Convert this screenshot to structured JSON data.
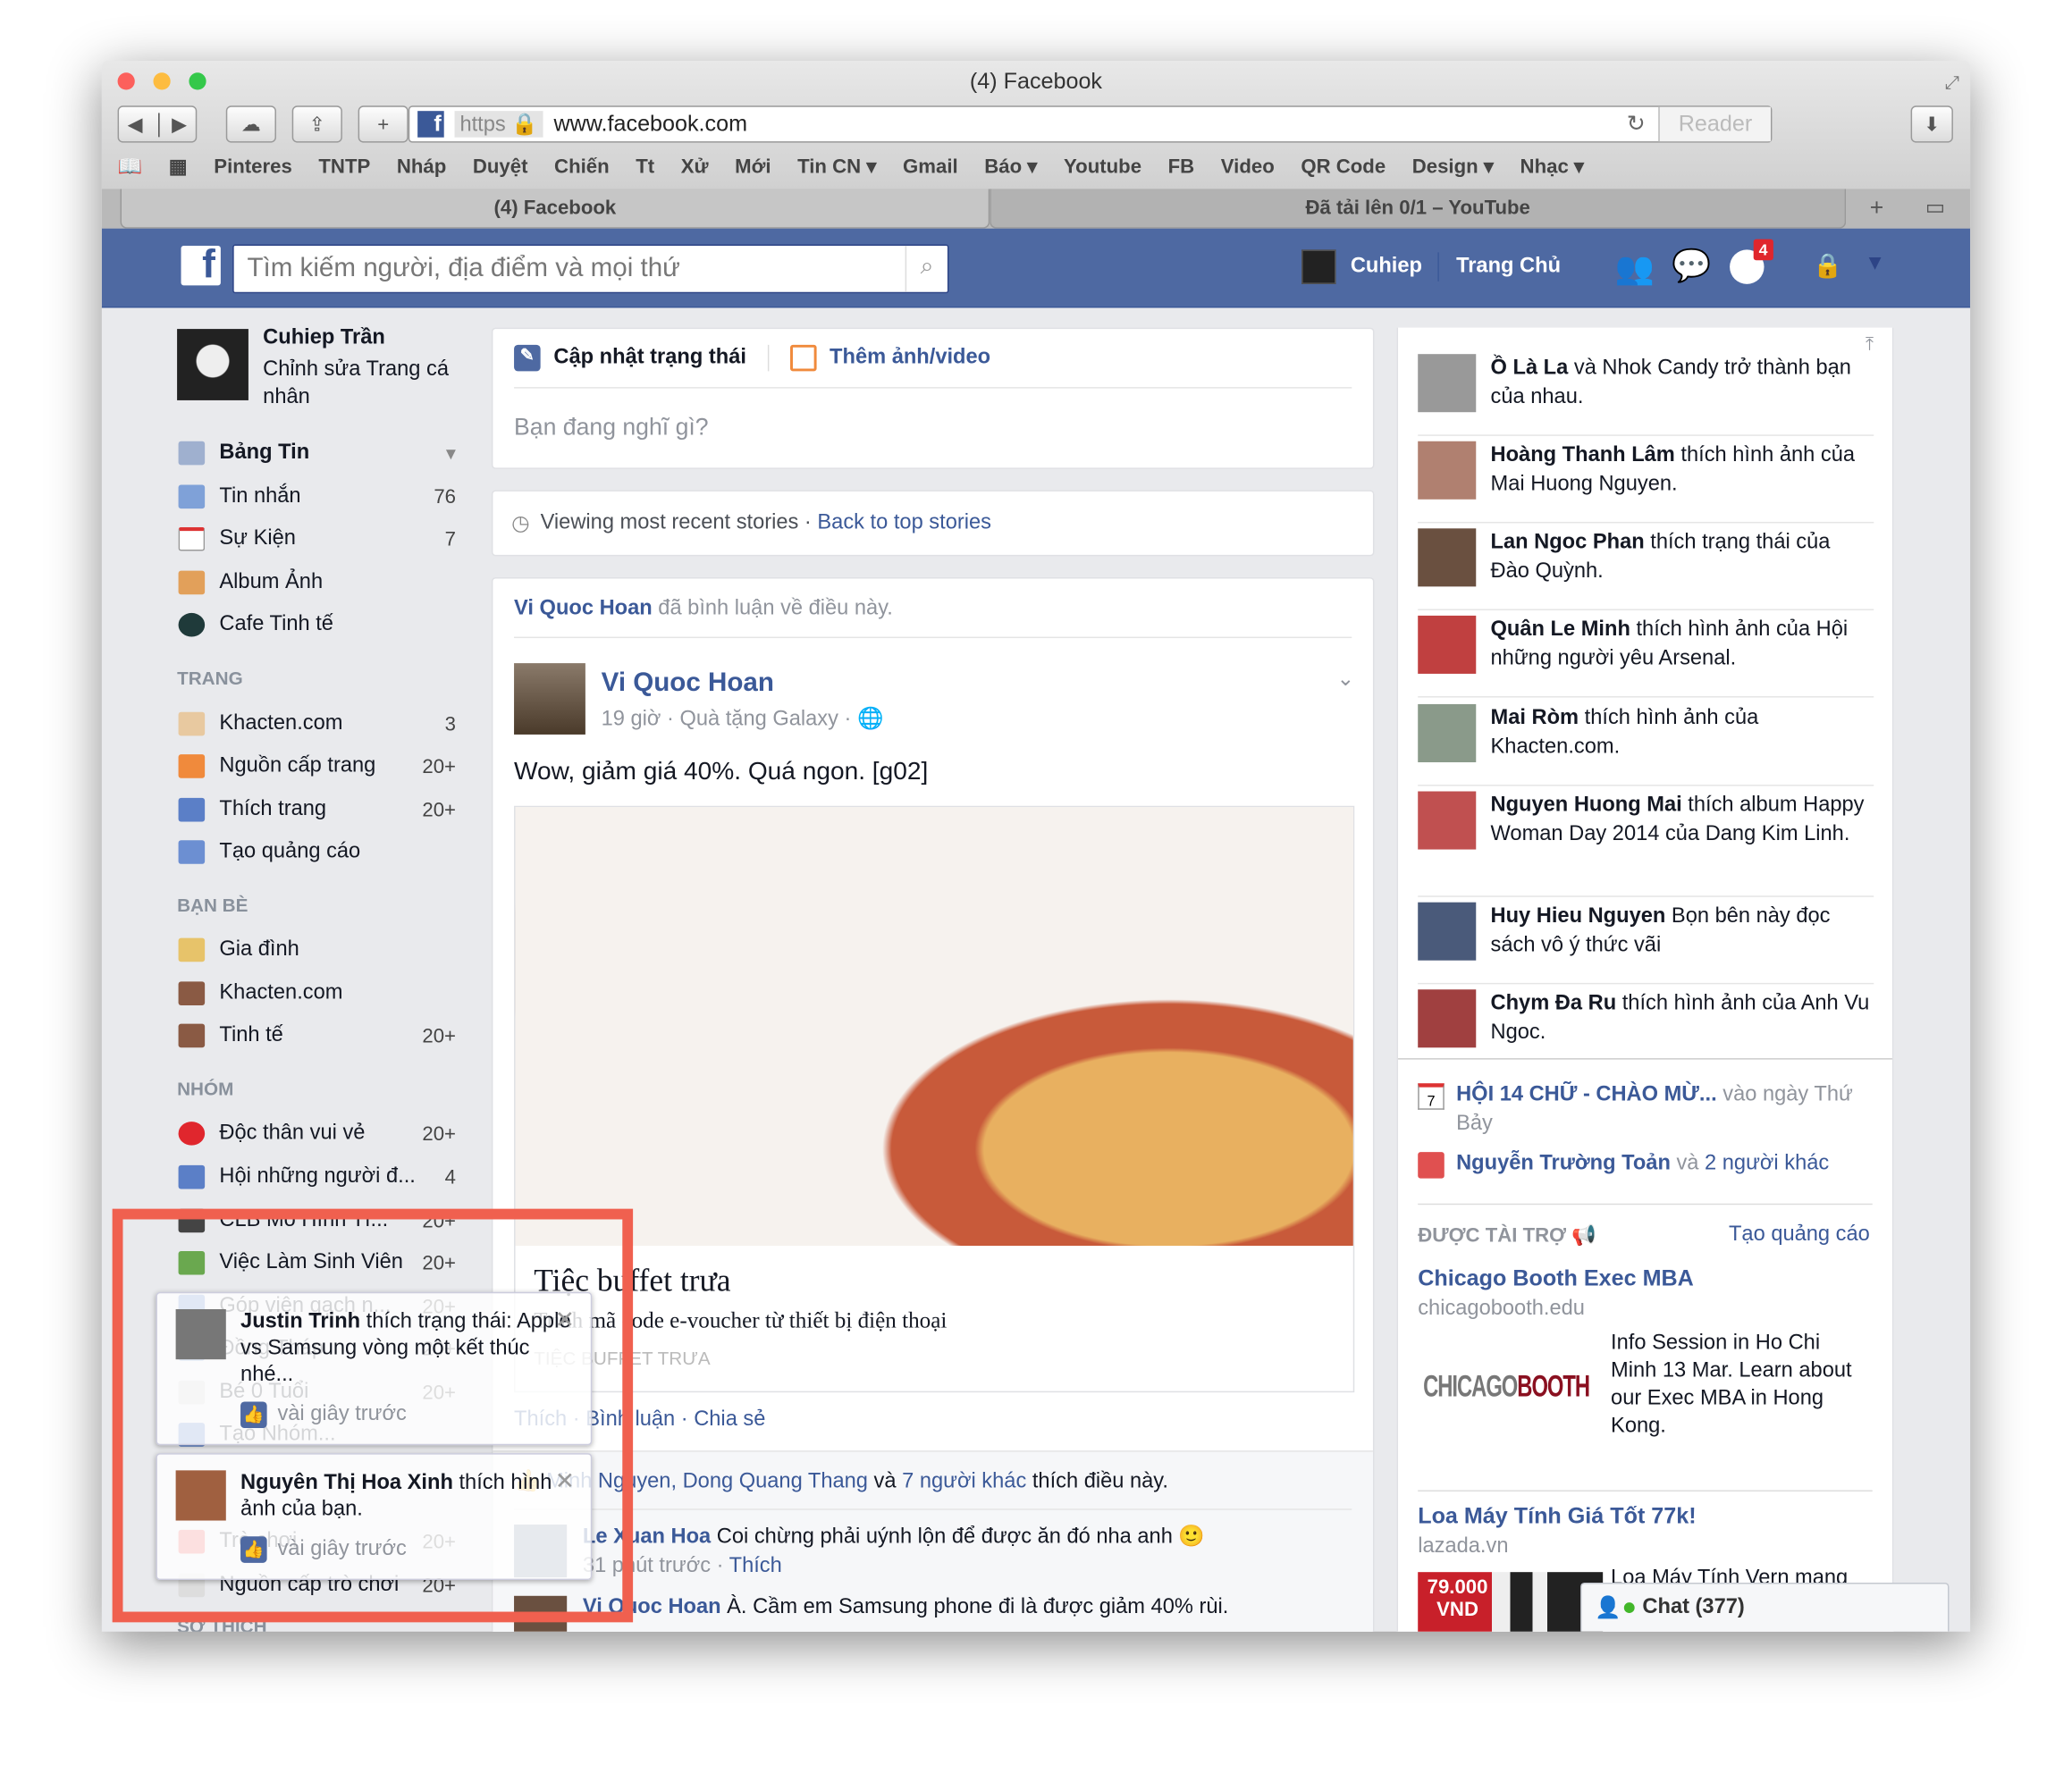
{
  "browser": {
    "window_title": "(4) Facebook",
    "https_label": "https",
    "url": "www.facebook.com",
    "reader_label": "Reader",
    "bookmarks": [
      "Pinteres",
      "TNTP",
      "Nháp",
      "Duyệt",
      "Chiến",
      "Tt",
      "Xử",
      "Mới",
      "Tin CN ▾",
      "Gmail",
      "Báo ▾",
      "Youtube",
      "FB",
      "Video",
      "QR Code",
      "Design ▾",
      "Nhạc ▾"
    ],
    "tabs": [
      {
        "label": "(4) Facebook",
        "active": true
      },
      {
        "label": "Đã tải lên 0/1 – YouTube",
        "active": false
      }
    ],
    "colors": {
      "close": "#fc605c",
      "minimize": "#fdbc40",
      "zoom": "#34c84a"
    }
  },
  "header": {
    "search_placeholder": "Tìm kiếm người, địa điểm và mọi thứ",
    "user": "Cuhiep",
    "home": "Trang Chủ",
    "notification_count": "4",
    "brand_color": "#4e69a2"
  },
  "left": {
    "profile_name": "Cuhiep Trần",
    "profile_edit": "Chỉnh sửa Trang cá nhân",
    "favorites": [
      {
        "label": "Bảng Tin",
        "count": "▾",
        "icon": "news-feed-icon"
      },
      {
        "label": "Tin nhắn",
        "count": "76",
        "icon": "messages-icon"
      },
      {
        "label": "Sự Kiện",
        "count": "7",
        "icon": "calendar-icon"
      },
      {
        "label": "Album Ảnh",
        "count": "",
        "icon": "photos-icon"
      },
      {
        "label": "Cafe Tinh tế",
        "count": "",
        "icon": "group-icon"
      }
    ],
    "pages_heading": "TRANG",
    "pages": [
      {
        "label": "Khacten.com",
        "count": "3"
      },
      {
        "label": "Nguồn cấp trang",
        "count": "20+"
      },
      {
        "label": "Thích trang",
        "count": "20+"
      },
      {
        "label": "Tạo quảng cáo",
        "count": ""
      }
    ],
    "friends_heading": "BẠN BÈ",
    "friends": [
      {
        "label": "Gia đình",
        "count": ""
      },
      {
        "label": "Khacten.com",
        "count": ""
      },
      {
        "label": "Tinh tế",
        "count": "20+"
      }
    ],
    "groups_heading": "NHÓM",
    "groups": [
      {
        "label": "Độc thân vui vẻ",
        "count": "20+"
      },
      {
        "label": "Hội những người đ...",
        "count": "4"
      },
      {
        "label": "CLB Mô Hình Tĩ...",
        "count": "20+"
      },
      {
        "label": "Việc Làm Sinh Viên",
        "count": "20+"
      },
      {
        "label": "Góp viên gạch n...",
        "count": "20+"
      },
      {
        "label": "Đồng Tháp",
        "count": "20+"
      },
      {
        "label": "Bé 0 Tuổi",
        "count": "20+"
      },
      {
        "label": "Tạo Nhóm...",
        "count": ""
      },
      {
        "label": "Trò chơi",
        "count": "20+"
      },
      {
        "label": "Nguồn cấp trò chơi",
        "count": "20+"
      }
    ],
    "interests_heading": "SỞ THÍCH"
  },
  "composer": {
    "status_tab": "Cập nhật trạng thái",
    "photo_tab": "Thêm ảnh/video",
    "placeholder": "Bạn đang nghĩ gì?"
  },
  "recent": {
    "text": "Viewing most recent stories ·",
    "link": "Back to top stories"
  },
  "post": {
    "story_actor": "Vi Quoc Hoan",
    "story_text": "đã bình luận về điều này.",
    "author": "Vi Quoc Hoan",
    "meta": "19 giờ · Quà tặng Galaxy ·",
    "text": "Wow, giảm giá 40%. Quá ngon. [g02]",
    "link_title": "Tiệc buffet trưa",
    "link_desc": "Trình mã code e-voucher từ thiết bị điện thoại",
    "link_domain": "TIỆC BUFFET TRƯA",
    "actions": [
      "Thích",
      "Bình luận",
      "Chia sẻ"
    ],
    "likes": {
      "names": "Minh Nguyen, Dong Quang Thang",
      "and": "và",
      "others": "7 người khác",
      "suffix": "thích điều này."
    },
    "comments": [
      {
        "author": "Le Xuan Hoa",
        "text": "Coi chừng phải uýnh lộn để được ăn đó nha anh 🙂",
        "time": "31 phút trước ·",
        "like": "Thích"
      },
      {
        "author": "Vi Quoc Hoan",
        "text": "À. Cầm em Samsung phone đi là được giảm 40% rùi."
      }
    ]
  },
  "ticker": [
    {
      "name": "Ồ Là La",
      "text": "và Nhok Candy trở thành bạn của nhau."
    },
    {
      "name": "Hoàng Thanh Lâm",
      "text": "thích hình ảnh của Mai Huong Nguyen."
    },
    {
      "name": "Lan Ngoc Phan",
      "text": "thích trạng thái của Đào Quỳnh."
    },
    {
      "name": "Quân Le Minh",
      "text": "thích hình ảnh của Hội những người yêu Arsenal."
    },
    {
      "name": "Mai Ròm",
      "text": "thích hình ảnh của Khacten.com."
    },
    {
      "name": "Nguyen Huong Mai",
      "text": "thích album Happy Woman Day 2014 của Dang Kim Linh."
    },
    {
      "name": "Huy Hieu Nguyen",
      "text": "Bọn bên này đọc sách vô ý thức vãi"
    },
    {
      "name": "Chym Đa Ru",
      "text": "thích hình ảnh của Anh Vu Ngoc."
    }
  ],
  "events": {
    "event_name": "HỘI 14 CHỮ - CHÀO MỪ...",
    "event_when": "vào ngày Thứ Bảy",
    "birthday_name": "Nguyễn Trường Toản",
    "birthday_and": "và",
    "birthday_others": "2 người khác"
  },
  "ads": {
    "heading": "ĐƯỢC TÀI TRỢ",
    "create": "Tạo quảng cáo",
    "items": [
      {
        "title": "Chicago Booth Exec MBA",
        "domain": "chicagobooth.edu",
        "body": "Info Session in Ho Chi Minh 13 Mar. Learn about our Exec MBA in Hong Kong.",
        "logo": "CHICAGO BOOTH"
      },
      {
        "title": "Loa Máy Tính Giá Tốt 77k!",
        "domain": "lazada.vn",
        "body": "Loa Máy Tính Vern mang",
        "price": "79.000 VND"
      }
    ]
  },
  "chat": {
    "label": "Chat (377)"
  },
  "notifications": [
    {
      "name": "Justin Trinh",
      "text": "thích trạng thái: Apple vs Samsung vòng một kết thúc nhé...",
      "time": "vài giây trước"
    },
    {
      "name": "Nguyên Thị Hoa Xinh",
      "text": "thích hình ảnh của bạn.",
      "time": "vài giây trước"
    }
  ]
}
